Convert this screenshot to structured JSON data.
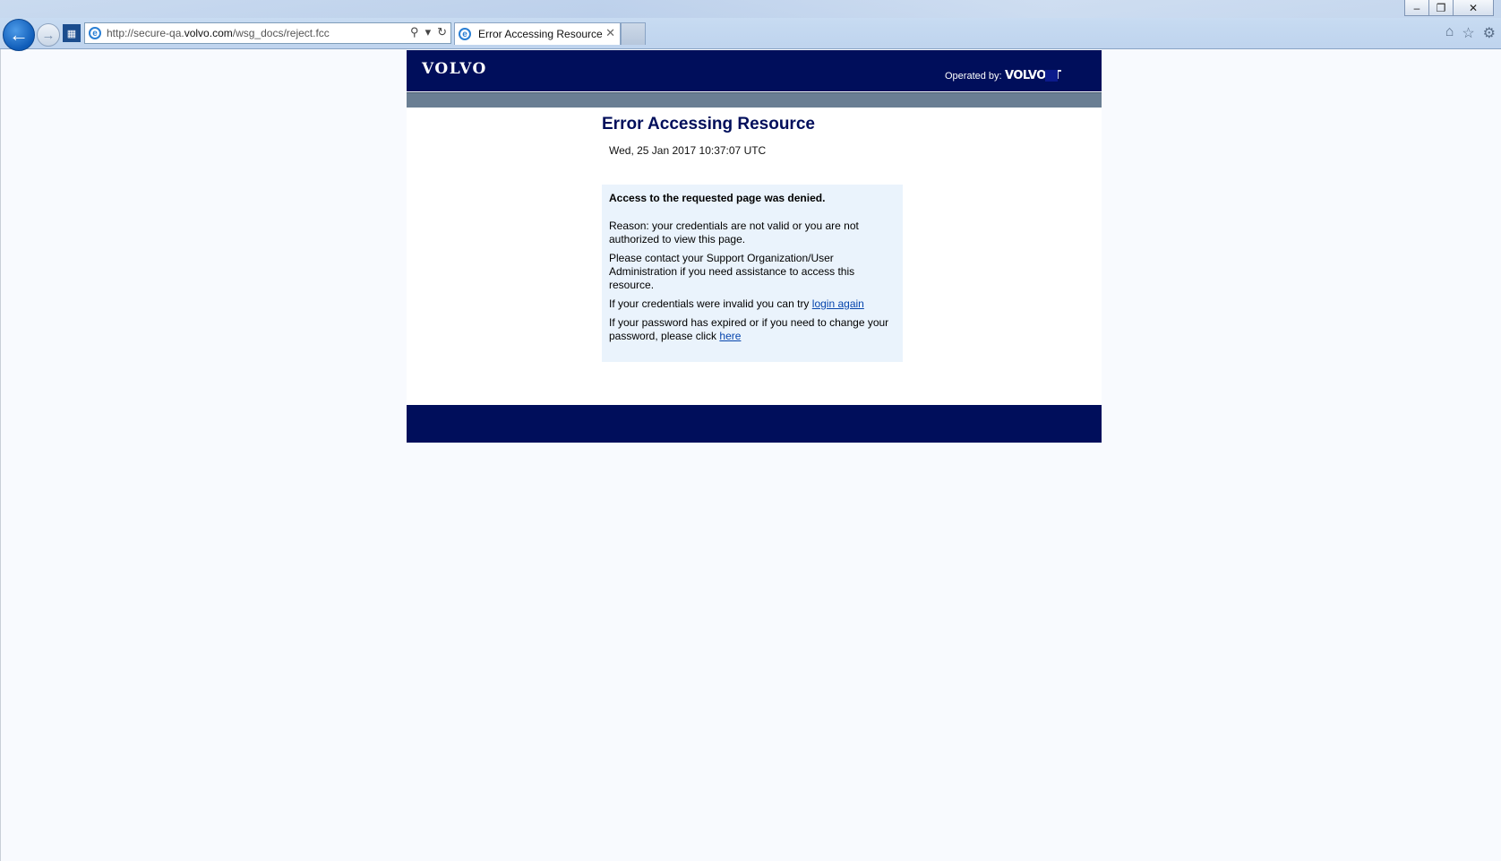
{
  "browser": {
    "url_prefix": "http://secure-qa.",
    "url_domain": "volvo.com",
    "url_path": "/wsg_docs/reject.fcc",
    "tab_title": "Error Accessing Resource"
  },
  "header": {
    "logo": "VOLVO",
    "operated_by": "Operated by:",
    "operator": "VOLVO IT"
  },
  "main": {
    "title": "Error Accessing Resource",
    "date": "Wed, 25 Jan 2017 10:37:07 UTC",
    "denied": "Access to the requested page was denied.",
    "reason": "Reason: your credentials are not valid or you are not authorized to view this page.",
    "contact": "Please contact your Support Organization/User Administration if you need assistance to access this resource.",
    "retry_text": "If your credentials were invalid you can try ",
    "retry_link": "login again",
    "password_text": "If your password has expired or if you need to change your password, please click ",
    "password_link": "here"
  }
}
